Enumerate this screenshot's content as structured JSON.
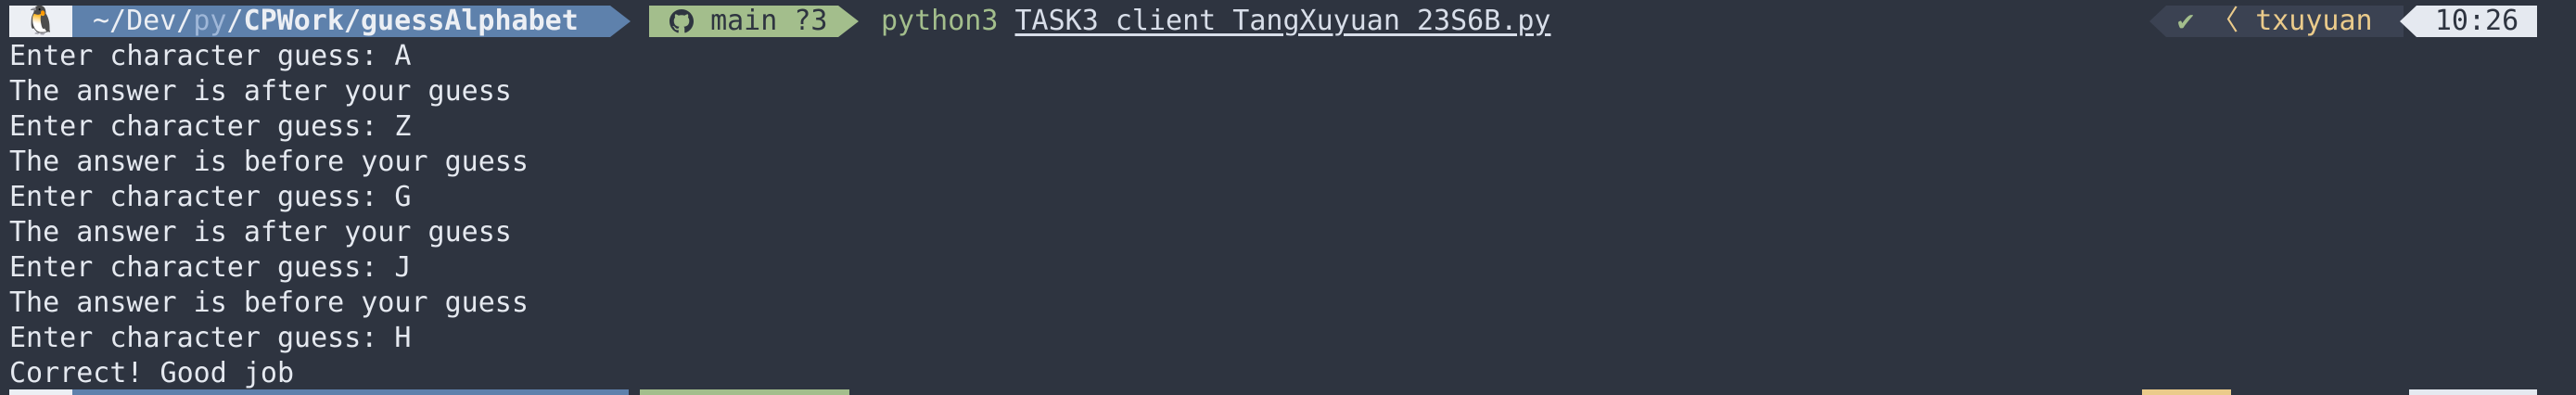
{
  "colors": {
    "background": "#2e3440",
    "os_segment": "#eceff4",
    "path_segment": "#5e81ac",
    "git_segment": "#a3be8c",
    "status_segment": "#3b4252",
    "time_segment": "#e5e9f0",
    "text": "#e5e9f0"
  },
  "prompt": {
    "os_icon": "penguin-icon",
    "os_glyph": "🐧",
    "path_prefix": "~/Dev/",
    "path_dim": "py",
    "path_sep": "/",
    "path_main": "CPWork/guessAlphabet",
    "git_icon": "github-octocat-icon",
    "git_glyph": "",
    "git_branch": "main ?3",
    "command_program": "python3",
    "command_file": "TASK3_client_TangXuyuan_23S6B.py"
  },
  "right_prompt": {
    "status_check": "✔",
    "status_sep": "〈",
    "user": "txuyuan",
    "time": "10:26"
  },
  "output_lines": [
    "Enter character guess: A",
    "The answer is after your guess",
    "Enter character guess: Z",
    "The answer is before your guess",
    "Enter character guess: G",
    "The answer is after your guess",
    "Enter character guess: J",
    "The answer is before your guess",
    "Enter character guess: H",
    "Correct! Good job"
  ]
}
